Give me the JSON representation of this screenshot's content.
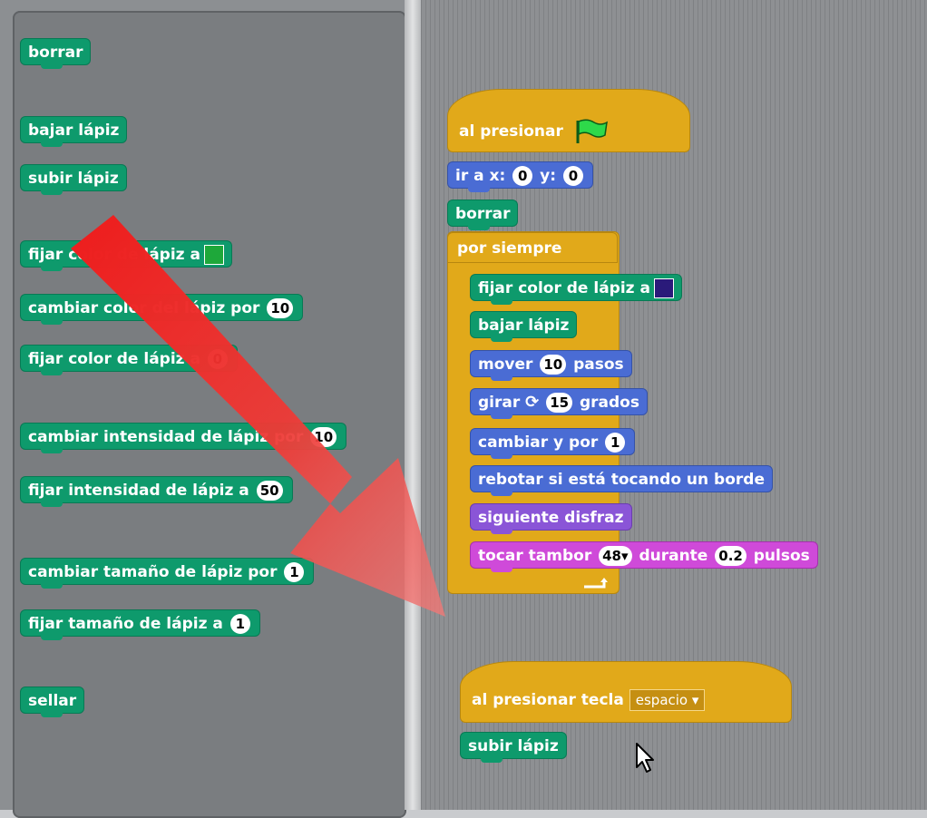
{
  "palette": {
    "blocks": [
      {
        "label": "borrar"
      },
      {
        "label": "bajar lápiz"
      },
      {
        "label": "subir lápiz"
      },
      {
        "label": "fijar color de lápiz a",
        "swatch": "#1ea83a"
      },
      {
        "label": "cambiar color del lápiz por",
        "value": "10"
      },
      {
        "label": "fijar color de lápiz a",
        "value": "0"
      },
      {
        "label": "cambiar intensidad de lápiz por",
        "value": "10"
      },
      {
        "label": "fijar intensidad de lápiz a",
        "value": "50"
      },
      {
        "label": "cambiar tamaño de lápiz por",
        "value": "1"
      },
      {
        "label": "fijar tamaño de lápiz a",
        "value": "1"
      },
      {
        "label": "sellar"
      }
    ]
  },
  "script1": {
    "hat_label": "al presionar",
    "flag_icon": "green-flag-icon",
    "goto": {
      "label": "ir a x:",
      "x": "0",
      "ylabel": "y:",
      "y": "0"
    },
    "clear": "borrar",
    "forever": "por siempre",
    "inner": {
      "set_color": "fijar color de lápiz a",
      "set_color_swatch": "#2a1a7a",
      "pen_down": "bajar lápiz",
      "move_label": "mover",
      "move_value": "10",
      "move_unit": "pasos",
      "turn_label": "girar",
      "turn_value": "15",
      "turn_unit": "grados",
      "change_y_label": "cambiar y por",
      "change_y_value": "1",
      "bounce": "rebotar si está tocando un borde",
      "next_costume": "siguiente disfraz",
      "drum_label": "tocar tambor",
      "drum_value": "48",
      "drum_during": "durante",
      "drum_beats": "0.2",
      "drum_unit": "pulsos"
    }
  },
  "script2": {
    "hat_label": "al presionar tecla",
    "key": "espacio",
    "pen_up": "subir lápiz"
  },
  "colors": {
    "pen": "#0e9a6c",
    "motion": "#4a6cd4",
    "control": "#e1a91a",
    "looks": "#8a55d7",
    "sound": "#cf4ad9",
    "arrow": "#e8231f"
  }
}
